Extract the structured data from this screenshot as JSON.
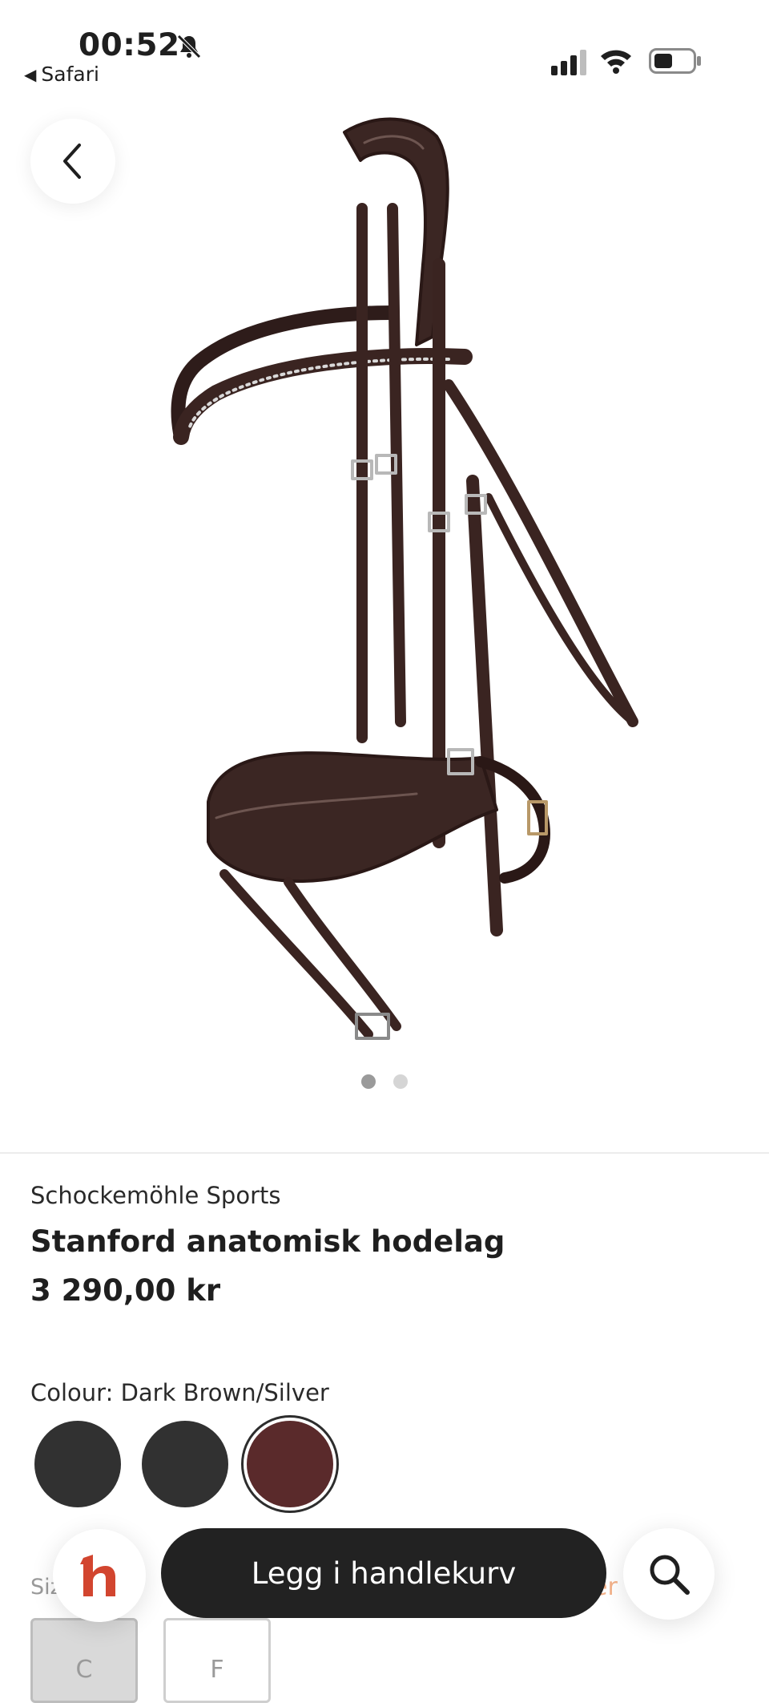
{
  "status_bar": {
    "time": "00:52",
    "back_app": "Safari",
    "icons": [
      "bell-slash-icon",
      "signal-icon",
      "wifi-icon",
      "battery-icon"
    ]
  },
  "gallery": {
    "image_alt": "brown leather bridle",
    "page_count": 2,
    "current_page": 1
  },
  "product": {
    "brand": "Schockemöhle Sports",
    "name": "Stanford anatomisk hodelag",
    "price": "3 290,00 kr"
  },
  "colour": {
    "label": "Colour: Dark Brown/Silver",
    "swatches": [
      {
        "color": "#313131",
        "selected": false
      },
      {
        "color": "#313131",
        "selected": false
      },
      {
        "color": "#5a2a2b",
        "selected": true
      }
    ]
  },
  "size": {
    "label": "Siz",
    "guide": "er",
    "options": [
      "C",
      "F"
    ],
    "selected": "C"
  },
  "actions": {
    "logo_letter": "h",
    "add_to_cart": "Legg i handlekurv"
  },
  "colors": {
    "accent": "#d2452f",
    "button_dark": "#222222"
  }
}
